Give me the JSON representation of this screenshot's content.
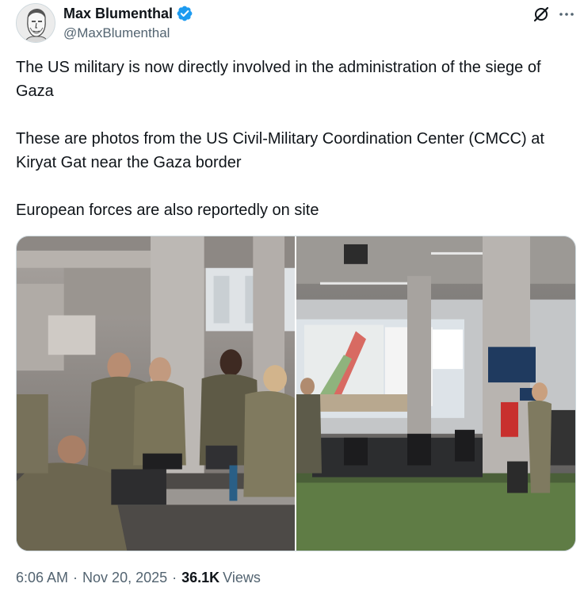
{
  "author": {
    "display_name": "Max Blumenthal",
    "handle": "@MaxBlumenthal",
    "verified": true,
    "verified_color": "#1d9bf0",
    "avatar_icon": "profile-sketch-avatar"
  },
  "header_actions": {
    "grok_icon": "grok-icon",
    "more_icon": "more-horizontal-icon"
  },
  "tweet": {
    "paragraphs": [
      "The US military is now directly involved in the administration of the siege of Gaza",
      "These are photos from the US Civil-Military Coordination Center (CMCC) at Kiryat Gat near the Gaza border",
      "European forces are also reportedly on site"
    ]
  },
  "media": {
    "photos": [
      {
        "name": "soldiers-at-workstations-photo"
      },
      {
        "name": "operations-center-map-screen-photo"
      }
    ]
  },
  "meta": {
    "time": "6:06 AM",
    "date": "Nov 20, 2025",
    "views_count": "36.1K",
    "views_label": "Views"
  },
  "colors": {
    "text_primary": "#0f1419",
    "text_secondary": "#536471",
    "border": "#cfd9de"
  }
}
